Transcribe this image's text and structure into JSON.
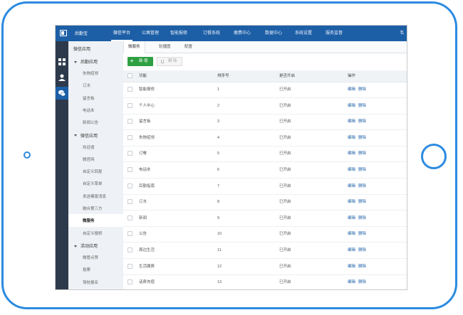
{
  "header": {
    "brand": "后勤宝",
    "nav": [
      "微信平台",
      "公寓管理",
      "智能报修",
      "订餐系统",
      "缴费中心",
      "数据中心",
      "系统设置",
      "服务监督"
    ],
    "active_nav": 0,
    "right_text": "韦"
  },
  "iconbar": {
    "icons": [
      "grid-icon",
      "user-icon",
      "wechat-icon"
    ],
    "active": 2
  },
  "sidebar": {
    "title": "微信应用",
    "groups": [
      {
        "label": "后勤应用",
        "items": [
          "失物招领",
          "订水",
          "留言板",
          "电话本",
          "新闻公告"
        ]
      },
      {
        "label": "微信应用",
        "items": [
          "欢迎语",
          "微官网",
          "自定义回复",
          "自定义菜单",
          "发送模版消息",
          "融合第三方",
          "微服务",
          "自定义报修"
        ]
      },
      {
        "label": "活动应用",
        "items": [
          "微管点赞",
          "投票",
          "驾校报名"
        ]
      }
    ],
    "active_item": "微服务"
  },
  "tabs": [
    "微服务",
    "轮播图",
    "配置"
  ],
  "active_tab": 0,
  "toolbar": {
    "add_label": "新 增",
    "delete_label": "删 除"
  },
  "table": {
    "headers": [
      "功能",
      "排序号",
      "是否开启",
      "操作"
    ],
    "rows": [
      {
        "name": "智能报修",
        "order": "1",
        "status": "已开启"
      },
      {
        "name": "个人中心",
        "order": "2",
        "status": "已开启"
      },
      {
        "name": "留言板",
        "order": "3",
        "status": "已开启"
      },
      {
        "name": "失物招领",
        "order": "4",
        "status": "已开启"
      },
      {
        "name": "订餐",
        "order": "5",
        "status": "已开启"
      },
      {
        "name": "电话本",
        "order": "6",
        "status": "已开启"
      },
      {
        "name": "后勤指南",
        "order": "7",
        "status": "已开启"
      },
      {
        "name": "订水",
        "order": "8",
        "status": "已开启"
      },
      {
        "name": "新闻",
        "order": "9",
        "status": "已开启"
      },
      {
        "name": "公告",
        "order": "10",
        "status": "已开启"
      },
      {
        "name": "周边生活",
        "order": "11",
        "status": "已开启"
      },
      {
        "name": "生活缴费",
        "order": "12",
        "status": "已开启"
      },
      {
        "name": "话费充值",
        "order": "13",
        "status": "已开启"
      }
    ],
    "edit_label": "编辑",
    "delete_label": "删除"
  },
  "colors": {
    "frame": "#2c8be0",
    "topbar": "#1d5fa6",
    "iconbar": "#2d3a4b",
    "add_button": "#2ea043",
    "link": "#1d5fa6"
  }
}
